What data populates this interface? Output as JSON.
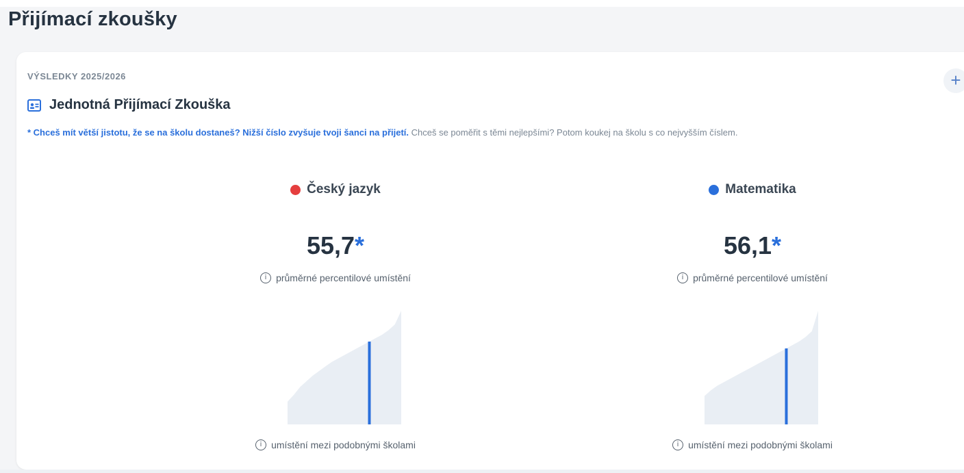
{
  "page": {
    "title": "Přijímací zkoušky"
  },
  "card": {
    "overline": "VÝSLEDKY 2025/2026",
    "plus_label": "+",
    "exam_title": "Jednotná Přijímací Zkouška",
    "exam_icon": "id-card-icon",
    "note_highlight": "* Chceš mít větší jistotu, že se na školu dostaneš? Nižší číslo zvyšuje tvoji šanci na přijetí.",
    "note_rest": " Chceš se poměřit s těmi nejlepšími? Potom koukej na školu s co nejvyšším číslem."
  },
  "subjects": [
    {
      "name": "Český jazyk",
      "dot_color": "#e53e3e",
      "score": "55,7",
      "star": "*",
      "metric_label": "průměrné percentilové umístění",
      "position_label": "umístění mezi podobnými školami",
      "marker_fraction": 0.72,
      "distribution": [
        0.2,
        0.26,
        0.33,
        0.38,
        0.43,
        0.47,
        0.51,
        0.55,
        0.58,
        0.61,
        0.64,
        0.67,
        0.7,
        0.73,
        0.76,
        0.79,
        0.83,
        0.88,
        1.0
      ]
    },
    {
      "name": "Matematika",
      "dot_color": "#2a6fdb",
      "score": "56,1",
      "star": "*",
      "metric_label": "průměrné percentilové umístění",
      "position_label": "umístění mezi podobnými školami",
      "marker_fraction": 0.72,
      "distribution": [
        0.25,
        0.3,
        0.34,
        0.37,
        0.4,
        0.43,
        0.46,
        0.49,
        0.52,
        0.55,
        0.58,
        0.61,
        0.64,
        0.67,
        0.7,
        0.73,
        0.77,
        0.82,
        1.0
      ]
    }
  ],
  "colors": {
    "accent": "#2a6fdb",
    "distribution_fill": "#e9eef4",
    "marker": "#2a6fdb"
  }
}
